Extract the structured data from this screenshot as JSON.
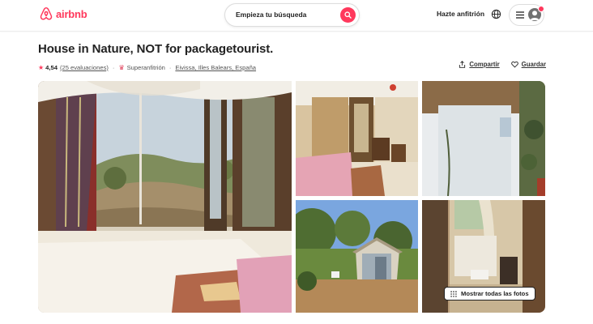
{
  "header": {
    "logo_text": "airbnb",
    "search_placeholder": "Empieza tu búsqueda",
    "host_link": "Hazte anfitrión",
    "icons": [
      "airbnb-logo-icon",
      "search-icon",
      "globe-icon",
      "menu-icon",
      "user-avatar-icon"
    ],
    "brand_color": "#ff385c"
  },
  "listing": {
    "title": "House in Nature, NOT for packagetourist.",
    "rating": "4,54",
    "reviews": "(25 evaluaciones)",
    "superhost": "Superanfitrión",
    "location": "Eivissa, Illes Balears, España",
    "share_label": "Compartir",
    "save_label": "Guardar"
  },
  "gallery": {
    "photos": [
      "room-window-view-photo",
      "bedroom-interior-photo",
      "curtain-window-photo",
      "small-house-exterior-photo",
      "shower-room-photo"
    ],
    "show_all_label": "Mostrar todas las fotos"
  }
}
